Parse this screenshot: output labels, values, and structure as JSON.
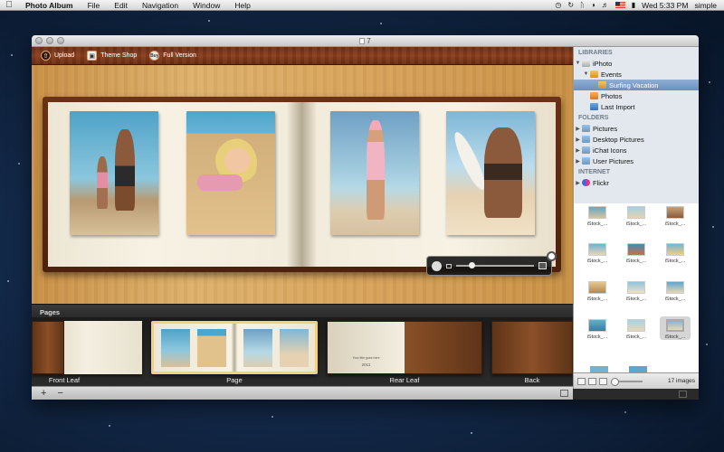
{
  "menubar": {
    "apple": "",
    "items": [
      "Photo Album",
      "File",
      "Edit",
      "Navigation",
      "Window",
      "Help"
    ],
    "clock": "Wed 5:33 PM",
    "user": "simple"
  },
  "window": {
    "title": "7"
  },
  "toolbar": {
    "upload_label": "Upload",
    "theme_shop_label": "Theme Shop",
    "full_version_label": "Full Version",
    "buy_badge": "Buy"
  },
  "pages": {
    "heading": "Pages",
    "thumbnails": [
      {
        "label": "Front Leaf"
      },
      {
        "label": "Page"
      },
      {
        "label": "Rear Leaf"
      },
      {
        "label": "Back"
      }
    ],
    "rear_text_1": "Your title goes here",
    "rear_text_2": "2011"
  },
  "sidebar": {
    "libraries_heading": "LIBRARIES",
    "iphoto": "iPhoto",
    "events": "Events",
    "surfing": "Surfing Vacation",
    "photos": "Photos",
    "last_import": "Last Import",
    "folders_heading": "FOLDERS",
    "folders": [
      "Pictures",
      "Desktop Pictures",
      "iChat Icons",
      "User Pictures"
    ],
    "internet_heading": "INTERNET",
    "flickr": "Flickr"
  },
  "grid": {
    "items": [
      "iStock_...",
      "iStock_...",
      "iStock_...",
      "iStock_...",
      "iStock_...",
      "iStock_...",
      "iStock_...",
      "iStock_...",
      "iStock_...",
      "iStock_...",
      "iStock_...",
      "iStock_..."
    ],
    "count_label": "17 images"
  },
  "bottombar": {
    "add": "+",
    "remove": "−"
  },
  "colors": {
    "wood_dark": "#6b2f16",
    "wood_light": "#ddb16a",
    "selection": "#f2d17c",
    "sidebar_bg": "#e3e8ee"
  }
}
